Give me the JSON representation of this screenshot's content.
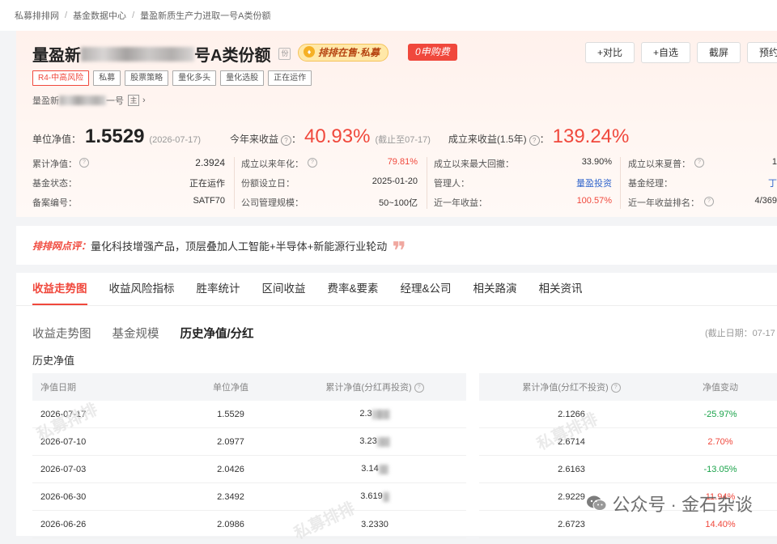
{
  "breadcrumb": [
    "私募排排网",
    "基金数据中心",
    "量盈新质生产力进取一号A类份额"
  ],
  "fund": {
    "title_prefix": "量盈新",
    "title_suffix": "号A类份额",
    "title_icon": "份",
    "sell_badge": "排排在售·私募",
    "fee_badge": "0申购费",
    "company_prefix": "量盈新",
    "company_suffix": "一号",
    "company_icon": "主"
  },
  "actions": [
    "+对比",
    "+自选",
    "截屏",
    "预约回电"
  ],
  "tags": [
    "R4-中高风险",
    "私募",
    "股票策略",
    "量化多头",
    "量化选股",
    "正在运作"
  ],
  "headline": {
    "nav_label": "单位净值：",
    "nav_value": "1.5529",
    "nav_date": "(2026-07-17)",
    "ytd_label": "今年来收益",
    "ytd_value": "40.93%",
    "ytd_note": "(截止至07-17)",
    "since_label": "成立来收益(1.5年)",
    "since_value": "139.24%"
  },
  "stats": {
    "col1": [
      {
        "label": "累计净值：",
        "value": "2.3924"
      },
      {
        "label": "基金状态：",
        "value": "正在运作"
      },
      {
        "label": "备案编号：",
        "value": "SATF70"
      }
    ],
    "col2": [
      {
        "label": "成立以来年化：",
        "value": "79.81%"
      },
      {
        "label": "份额设立日：",
        "value": "2025-01-20"
      },
      {
        "label": "公司管理规模：",
        "value": "50~100亿"
      }
    ],
    "col3": [
      {
        "label": "成立以来最大回撤：",
        "value": "33.90%"
      },
      {
        "label": "管理人：",
        "value": "量盈投资"
      },
      {
        "label": "近一年收益：",
        "value": "100.57%"
      }
    ],
    "col4": [
      {
        "label": "成立以来夏普：",
        "value": "1"
      },
      {
        "label": "基金经理：",
        "value": "丁"
      },
      {
        "label": "近一年收益排名：",
        "value": "4/369"
      }
    ]
  },
  "review": {
    "label": "排排网点评：",
    "text": "量化科技增强产品，顶层叠加人工智能+半导体+新能源行业轮动",
    "quote": "❞"
  },
  "tabs": [
    "收益走势图",
    "收益风险指标",
    "胜率统计",
    "区间收益",
    "费率&要素",
    "经理&公司",
    "相关路演",
    "相关资讯"
  ],
  "subtabs": [
    "收益走势图",
    "基金规模",
    "历史净值/分红"
  ],
  "as_of": "(截止日期：07-17",
  "section_title": "历史净值",
  "table": {
    "headers": [
      "净值日期",
      "单位净值",
      "累计净值(分红再投资)",
      "累计净值(分红不投资)",
      "净值变动"
    ],
    "rows": [
      [
        "2026-07-17",
        "1.5529",
        "2.3",
        "2.1266",
        "-25.97%"
      ],
      [
        "2026-07-10",
        "2.0977",
        "3.23",
        "2.6714",
        "2.70%"
      ],
      [
        "2026-07-03",
        "2.0426",
        "3.14",
        "2.6163",
        "-13.05%"
      ],
      [
        "2026-06-30",
        "2.3492",
        "3.619",
        "2.9229",
        "11.94%"
      ],
      [
        "2026-06-26",
        "2.0986",
        "3.2330",
        "2.6723",
        "14.40%"
      ]
    ]
  },
  "watermark": {
    "text": "公众号 · 金石杂谈",
    "bg_text": "私募排排"
  },
  "colors": {
    "accent": "#f0483c",
    "positive": "#f0483c",
    "negative": "#1aa34a",
    "link": "#3366cc"
  }
}
